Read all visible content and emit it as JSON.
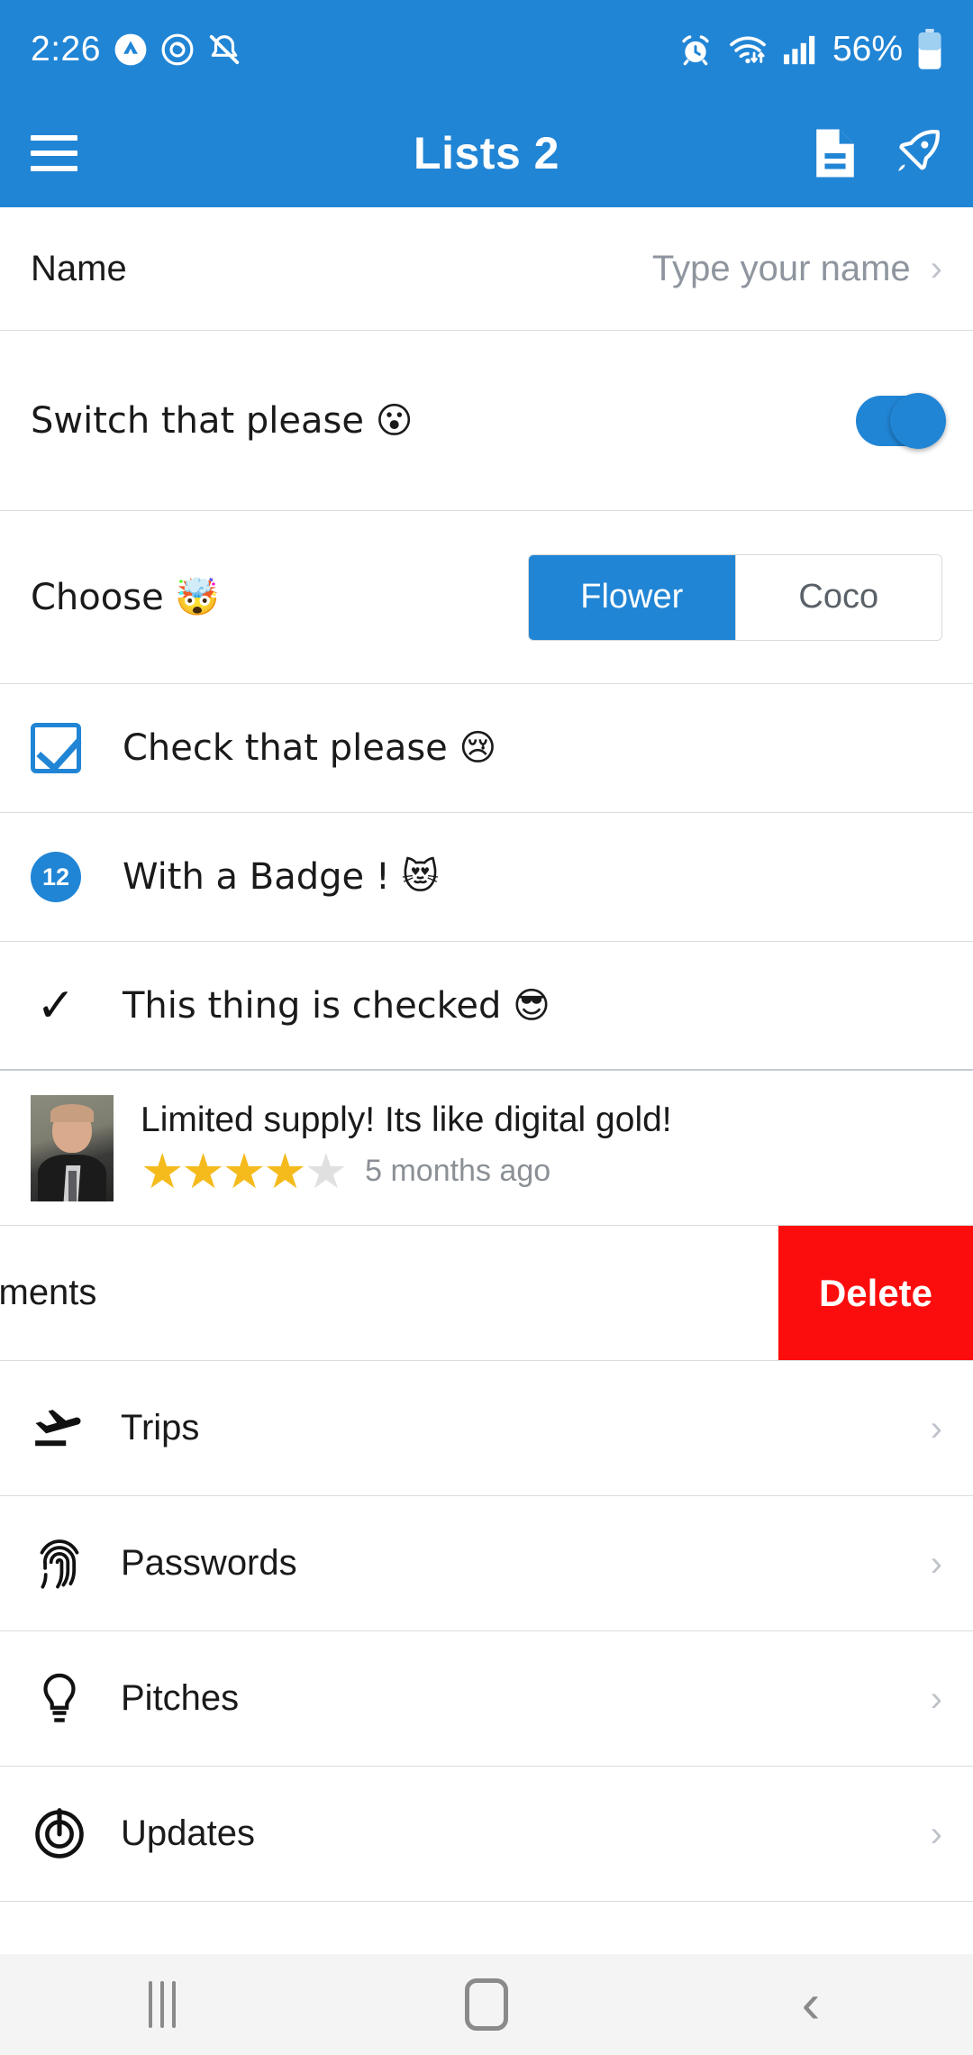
{
  "status_bar": {
    "time": "2:26",
    "battery_percent": "56%",
    "left_icons": [
      "app-badge-icon",
      "clock-circle-icon",
      "mute-vibrate-icon"
    ],
    "right_icons": [
      "alarm-icon",
      "wifi-icon",
      "signal-icon",
      "battery-icon"
    ],
    "background_color": "#2185d5"
  },
  "appbar": {
    "title": "Lists 2",
    "menu_icon": "hamburger-menu-icon",
    "actions": [
      "document-icon",
      "rocket-icon"
    ],
    "background_color": "#2185d5"
  },
  "rows": {
    "name": {
      "label": "Name",
      "placeholder": "Type your name",
      "value": "",
      "chevron": "›"
    },
    "switch": {
      "label": "Switch that please 😮",
      "state": "on",
      "accent_color": "#2185d5"
    },
    "choose": {
      "label": "Choose 🤯",
      "options": [
        {
          "label": "Flower",
          "selected": true
        },
        {
          "label": "Coco",
          "selected": false
        }
      ]
    },
    "check": {
      "label": "Check that please 😢",
      "checked": true
    },
    "badge_row": {
      "badge": "12",
      "label": "With a Badge ! 😻"
    },
    "checked_row": {
      "tick": "✓",
      "label": "This thing is checked 😎"
    },
    "review": {
      "title": "Limited supply! Its like digital gold!",
      "rating": 4,
      "max_rating": 5,
      "time": "5 months ago",
      "avatar": "user-photo"
    },
    "swipe": {
      "label": "ointments",
      "full_label": "Appointments",
      "chevron": "›",
      "delete_label": "Delete",
      "delete_color": "#fc0d0d"
    }
  },
  "list_items": [
    {
      "icon": "airplane-landing-icon",
      "label": "Trips",
      "chevron": "›"
    },
    {
      "icon": "fingerprint-icon",
      "label": "Passwords",
      "chevron": "›"
    },
    {
      "icon": "lightbulb-icon",
      "label": "Pitches",
      "chevron": "›"
    },
    {
      "icon": "target-power-icon",
      "label": "Updates",
      "chevron": "›"
    }
  ],
  "navbar": {
    "recents_label": "recents-icon",
    "home_label": "home-icon",
    "back_label": "back-icon"
  }
}
